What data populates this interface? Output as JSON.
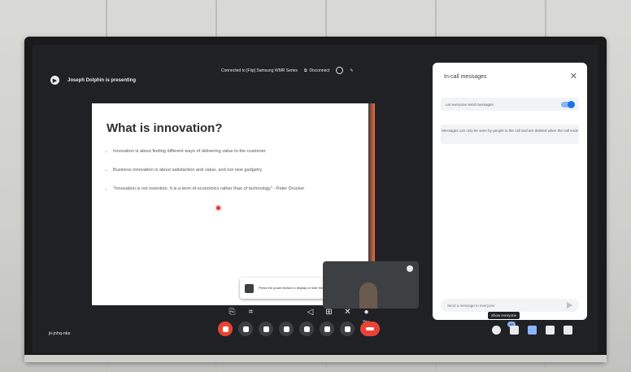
{
  "presenter": {
    "text": "Joseph Dolphin is presenting"
  },
  "cast": {
    "status": "Connected to [Flip] Samsung WMR Series",
    "disconnect": "Disconnect"
  },
  "slide": {
    "title": "What is innovation?",
    "bullets": [
      "Innovation is about finding different ways of delivering value to the customer",
      "Business innovation is about satisfaction and value, and not new gadgetry",
      "\"Innovation is not invention. It is a term of economics rather than of technology\" - Peter Drucker"
    ]
  },
  "self_view": {
    "label": "You"
  },
  "tooltip": {
    "text": "Press the power button to display or hide the floating menu."
  },
  "chat_panel": {
    "title": "In-call messages",
    "toggle_label": "Let everyone send messages",
    "toggle_on": true,
    "notice": "Messages can only be seen by people in the call and are deleted when the call ends",
    "input_placeholder": "Send a message to everyone"
  },
  "meeting": {
    "code": "jii-jnhq-nke"
  },
  "participants": {
    "count": "66",
    "tooltip": "Show everyone"
  },
  "colors": {
    "accent": "#1a73e8",
    "end_call": "#ea4335",
    "screen_bg": "#202124"
  }
}
